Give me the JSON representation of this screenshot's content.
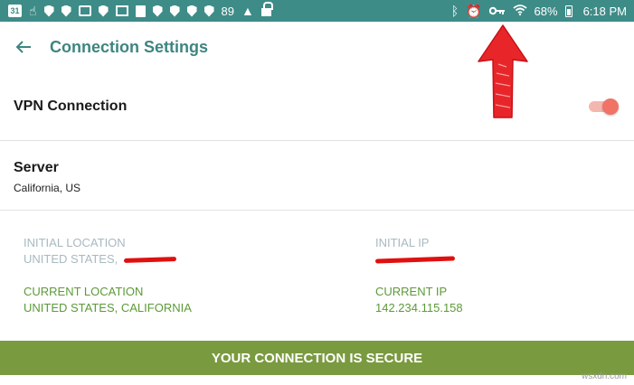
{
  "status_bar": {
    "left_icons": [
      "calendar-icon",
      "hand-icon",
      "shield-icon",
      "shield-icon",
      "photo-icon",
      "shield-icon",
      "grid-icon",
      "doc-icon",
      "shield-icon",
      "shield-icon",
      "shield-icon",
      "shield-icon"
    ],
    "calendar_day": "31",
    "temperature": "89",
    "right_icons": [
      "bluetooth-icon",
      "alarm-icon",
      "key-icon",
      "wifi-icon",
      "battery-icon"
    ],
    "battery": "68%",
    "time": "6:18 PM",
    "color": "#3e8c88"
  },
  "header": {
    "title": "Connection Settings"
  },
  "vpn": {
    "label": "VPN Connection",
    "enabled": true,
    "toggle_color": "#f07366"
  },
  "server": {
    "label": "Server",
    "value": "California, US"
  },
  "info": {
    "initial_location_label": "INITIAL LOCATION",
    "initial_location_value": "UNITED STATES,",
    "initial_ip_label": "INITIAL IP",
    "current_location_label": "CURRENT LOCATION",
    "current_location_value": "UNITED STATES, CALIFORNIA",
    "current_ip_label": "CURRENT IP",
    "current_ip_value": "142.234.115.158"
  },
  "secure_banner": {
    "text": "YOUR CONNECTION IS SECURE",
    "color": "#7a9a3f"
  },
  "watermark": "wsxdn.com"
}
